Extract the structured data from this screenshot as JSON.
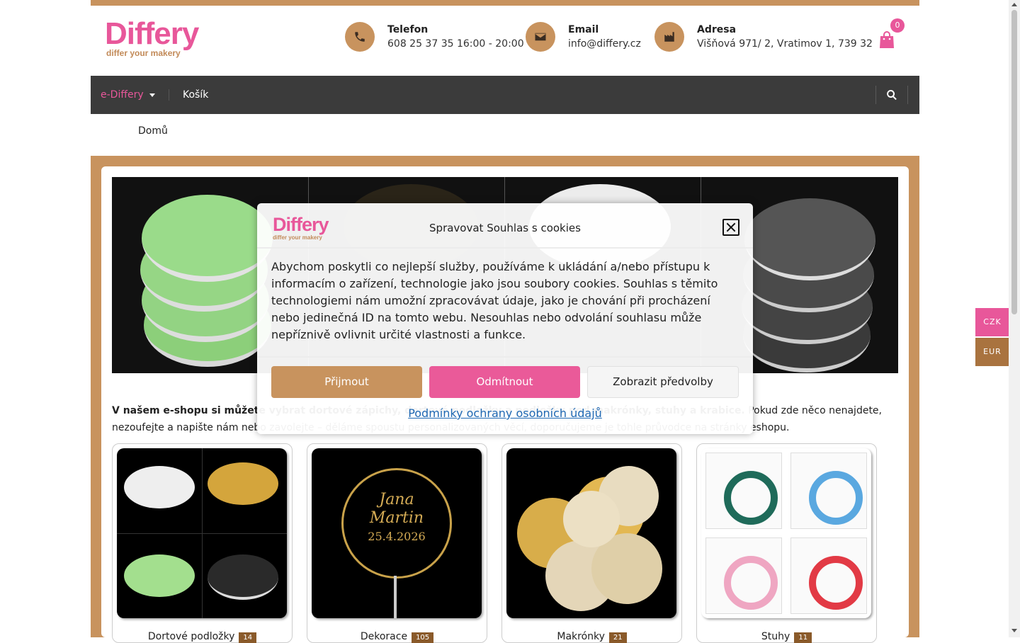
{
  "header": {
    "logo_text": "Differy",
    "logo_sub": "differ your makery",
    "phone_label": "Telefon",
    "phone_value": "608 25 37 35 16:00 - 20:00",
    "email_label": "Email",
    "email_value": "info@differy.cz",
    "address_label": "Adresa",
    "address_value": "Višňová 971/ 2, Vratimov 1, 739 32",
    "cart_count": "0"
  },
  "nav": {
    "ediffery": "e-Differy",
    "kosik": "Košík"
  },
  "breadcrumb": "Domů",
  "intro": {
    "bold": "V našem e-shopu si můžete vybrat dortové zápichy, dortové podložky a podložky pod makrónky, stuhy a krabice.",
    "rest": " Pokud zde něco nenajdete, nezoufejte a napište nám nebo zavolejte – děláme spoustu personalizovaných věcí, doporučujeme je tohle průvodce na stránky eshopu."
  },
  "products": [
    {
      "title": "Dortové podložky",
      "badge": "14"
    },
    {
      "title": "Dekorace",
      "badge": "105"
    },
    {
      "title": "Makrónky",
      "badge": "21"
    },
    {
      "title": "Stuhy",
      "badge": "11"
    }
  ],
  "cookie_modal": {
    "logo_text": "Differy",
    "logo_sub": "differ your makery",
    "title": "Spravovat Souhlas s cookies",
    "body": "Abychom poskytli co nejlepší služby, používáme k ukládání a/nebo přístupu k informacím o zařízení, technologie jako jsou soubory cookies. Souhlas s těmito technologiemi nám umožní zpracovávat údaje, jako je chování při procházení nebo jedinečná ID na tomto webu. Nesouhlas nebo odvolání souhlasu může nepříznivě ovlivnit určité vlastnosti a funkce.",
    "accept": "Přijmout",
    "deny": "Odmítnout",
    "prefs": "Zobrazit předvolby",
    "privacy_link": "Podmínky ochrany osobních údajů"
  },
  "currency": {
    "czk": "CZK",
    "eur": "EUR"
  },
  "colors": {
    "accent_pink": "#e8579a",
    "accent_tan": "#c8935e",
    "nav_bg": "#3b3b3b"
  }
}
